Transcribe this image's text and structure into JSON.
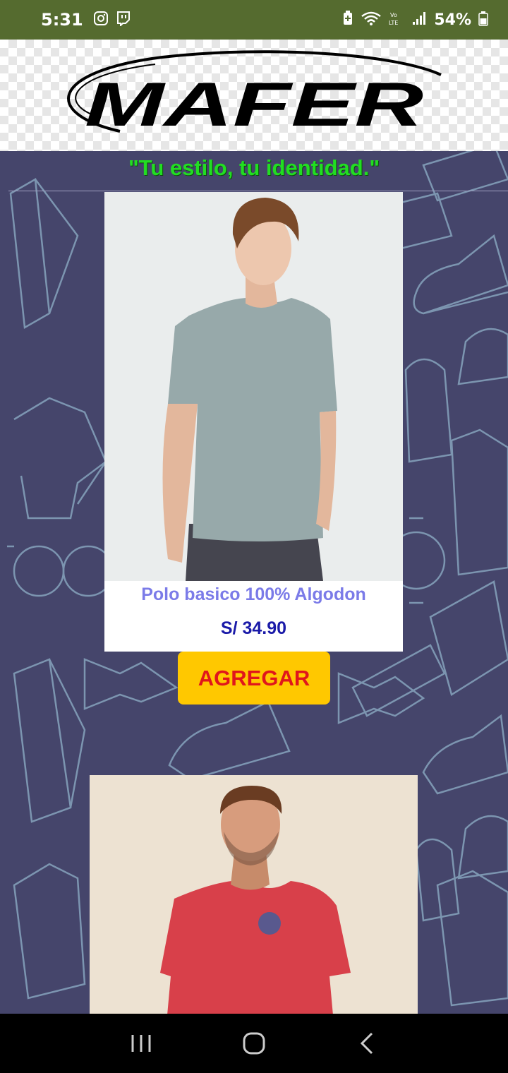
{
  "status_bar": {
    "time": "5:31",
    "battery": "54%",
    "left_icons": [
      "instagram-icon",
      "twitch-icon"
    ],
    "right_icons": [
      "battery-saver-icon",
      "wifi-icon",
      "volte-icon",
      "signal-icon",
      "battery-icon"
    ]
  },
  "header": {
    "logo_text": "MAFER"
  },
  "main": {
    "slogan": "\"Tu estilo, tu identidad.\"",
    "products": [
      {
        "name": "Polo basico 100% Algodon",
        "price": "S/ 34.90",
        "button_label": "AGREGAR"
      }
    ]
  },
  "nav_bar": {
    "icons": [
      "recent-apps-icon",
      "home-icon",
      "back-icon"
    ]
  },
  "colors": {
    "status_bar": "#556b2f",
    "page_bg": "#45456b",
    "slogan": "#22dd22",
    "product_name": "#7b7be8",
    "price": "#1a1aa8",
    "button_bg": "#ffc800",
    "button_text": "#e0161c"
  }
}
